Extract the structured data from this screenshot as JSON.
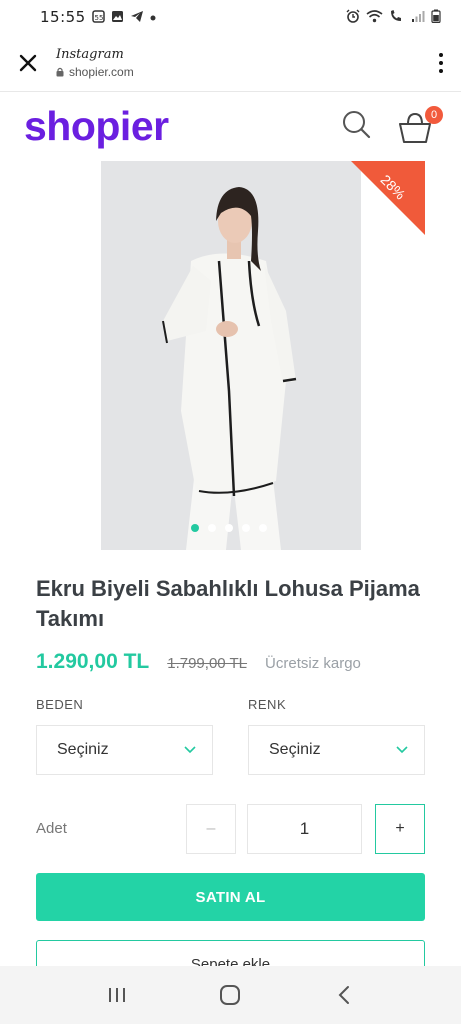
{
  "status_bar": {
    "time": "15:55",
    "left_icons": [
      "sim-icon",
      "gallery-icon",
      "telegram-icon",
      "dot-icon"
    ],
    "right_icons": [
      "alarm-icon",
      "wifi-icon",
      "call-icon",
      "signal-icon",
      "battery-icon"
    ]
  },
  "browser": {
    "title": "Instagram",
    "host": "shopier.com",
    "close_icon": "close-icon",
    "menu_icon": "more-vertical-icon"
  },
  "site": {
    "logo": "shopier",
    "brand_color": "#6b1fe0",
    "cart_count": "0"
  },
  "product": {
    "discount": "28%",
    "image_count": 5,
    "active_image": 1,
    "title": "Ekru Biyeli Sabahlıklı Lohusa Pijama Takımı",
    "price": "1.290,00 TL",
    "old_price": "1.799,00 TL",
    "shipping": "Ücretsiz kargo",
    "accent_color": "#23c9a0"
  },
  "options": {
    "size_label": "BEDEN",
    "size_value": "Seçiniz",
    "color_label": "RENK",
    "color_value": "Seçiniz"
  },
  "quantity": {
    "label": "Adet",
    "minus": "–",
    "value": "1",
    "plus": "+"
  },
  "actions": {
    "buy": "SATIN AL",
    "add_to_cart": "Sepete ekle"
  },
  "nav": {
    "recent_icon": "recent-apps-icon",
    "home_icon": "home-icon",
    "back_icon": "back-icon"
  }
}
